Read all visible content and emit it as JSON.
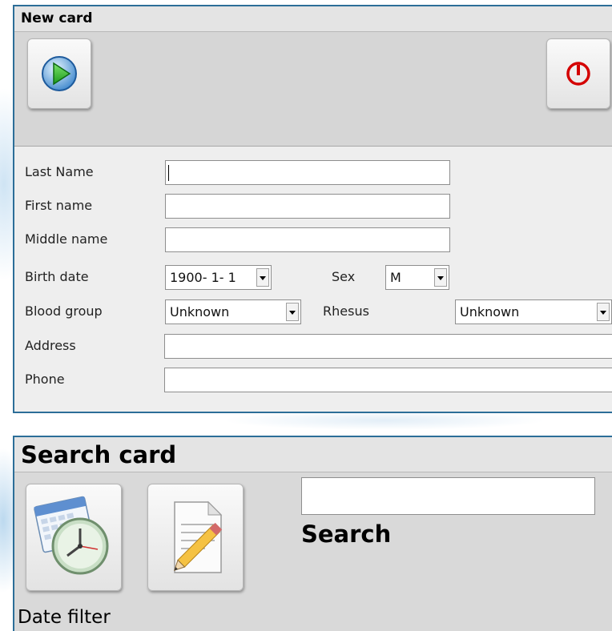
{
  "new_card": {
    "title": "New card",
    "toolbar": {
      "play_icon": "play-icon",
      "power_icon": "power-icon"
    },
    "fields": {
      "last_name_label": "Last Name",
      "last_name_value": "",
      "first_name_label": "First name",
      "first_name_value": "",
      "middle_name_label": "Middle name",
      "middle_name_value": "",
      "birth_date_label": "Birth date",
      "birth_date_value": "1900- 1- 1",
      "sex_label": "Sex",
      "sex_value": "M",
      "blood_group_label": "Blood group",
      "blood_group_value": "Unknown",
      "rhesus_label": "Rhesus",
      "rhesus_value": "Unknown",
      "address_label": "Address",
      "address_value": "",
      "phone_label": "Phone",
      "phone_value": ""
    }
  },
  "search_card": {
    "title": "Search card",
    "date_filter_label": "Date filter",
    "search_value": "",
    "search_label": "Search"
  },
  "colors": {
    "border_blue": "#2c6e98",
    "panel_gray": "#d6d6d6",
    "power_red": "#d40000",
    "play_green": "#2fb52f"
  }
}
